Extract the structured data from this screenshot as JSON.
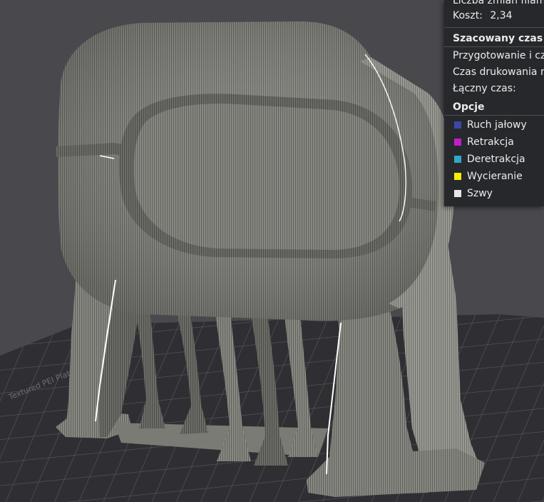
{
  "stats": {
    "filament_changes_label": "Liczba zmian filam",
    "cost_label": "Koszt:",
    "cost_value": "2,34"
  },
  "time": {
    "heading": "Szacowany czas",
    "prepare_label": "Przygotowanie i cz",
    "print_label": "Czas drukowania n",
    "total_label": "Łączny czas:"
  },
  "options": {
    "heading": "Opcje",
    "items": [
      {
        "label": "Ruch jałowy",
        "color": "#3b48a8"
      },
      {
        "label": "Retrakcja",
        "color": "#c21ec8"
      },
      {
        "label": "Deretrakcja",
        "color": "#2fa8c8"
      },
      {
        "label": "Wycieranie",
        "color": "#f5f000"
      },
      {
        "label": "Szwy",
        "color": "#e6e6e6"
      }
    ]
  },
  "plate": {
    "label": "Textured PEI Plate"
  }
}
